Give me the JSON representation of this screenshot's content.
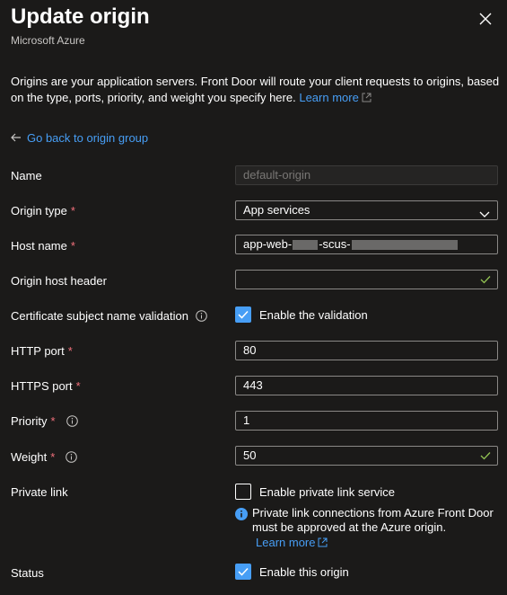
{
  "header": {
    "title": "Update origin",
    "subtitle": "Microsoft Azure",
    "close_icon": "close-icon"
  },
  "description": {
    "text": "Origins are your application servers. Front Door will route your client requests to origins, based on the type, ports, priority, and weight you specify here.",
    "learn_more": "Learn more"
  },
  "back_link": "Go back to origin group",
  "form": {
    "name": {
      "label": "Name",
      "value": "default-origin"
    },
    "origin_type": {
      "label": "Origin type",
      "required": "*",
      "value": "App services"
    },
    "host_name": {
      "label": "Host name",
      "required": "*",
      "value_prefix": "app-web-",
      "value_middle": "-scus-"
    },
    "origin_host_header": {
      "label": "Origin host header",
      "value": ""
    },
    "cert_validation": {
      "label": "Certificate subject name validation",
      "checkbox_label": "Enable the validation",
      "checked": true
    },
    "http_port": {
      "label": "HTTP port",
      "required": "*",
      "value": "80"
    },
    "https_port": {
      "label": "HTTPS port",
      "required": "*",
      "value": "443"
    },
    "priority": {
      "label": "Priority",
      "required": "*",
      "value": "1"
    },
    "weight": {
      "label": "Weight",
      "required": "*",
      "value": "50"
    },
    "private_link": {
      "label": "Private link",
      "checkbox_label": "Enable private link service",
      "checked": false,
      "note": "Private link connections from Azure Front Door must be approved at the Azure origin.",
      "learn_more": "Learn more"
    },
    "status": {
      "label": "Status",
      "checkbox_label": "Enable this origin",
      "checked": true
    }
  },
  "colors": {
    "accent": "#479ef5",
    "required": "#f1707b",
    "valid": "#92c353",
    "background": "#1b1a19"
  }
}
